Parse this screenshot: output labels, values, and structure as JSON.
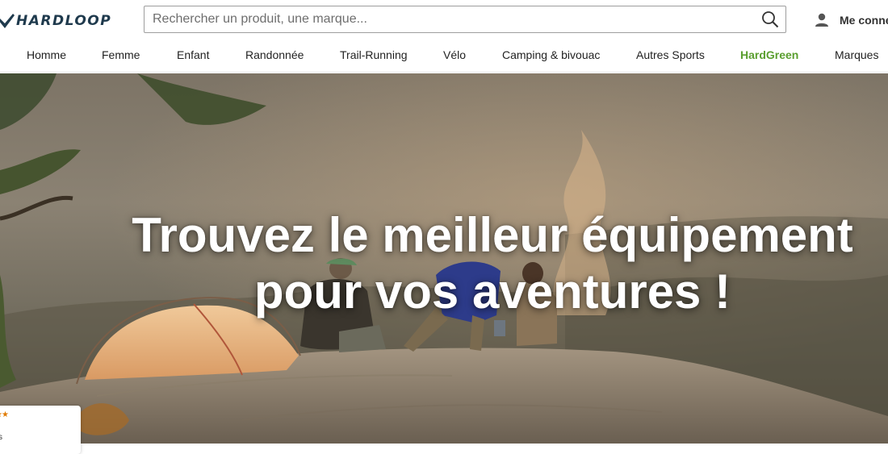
{
  "header": {
    "logo_text": "HARDLOOP",
    "search": {
      "placeholder": "Rechercher un produit, une marque..."
    },
    "account_label": "Me conne"
  },
  "nav": {
    "items": [
      {
        "label": "Homme"
      },
      {
        "label": "Femme"
      },
      {
        "label": "Enfant"
      },
      {
        "label": "Randonnée"
      },
      {
        "label": "Trail-Running"
      },
      {
        "label": "Vélo"
      },
      {
        "label": "Camping & bivouac"
      },
      {
        "label": "Autres Sports"
      },
      {
        "label": "HardGreen",
        "color": "#5a9e2f"
      },
      {
        "label": "Marques"
      }
    ]
  },
  "hero": {
    "title_line1": "Trouvez le meilleur équipement",
    "title_line2": "pour vos aventures !"
  },
  "review_widget": {
    "stars_text": "★★",
    "caption": "s"
  },
  "icons": {
    "logo": "hardloop-logo-icon",
    "search": "search-icon",
    "account": "user-icon"
  }
}
